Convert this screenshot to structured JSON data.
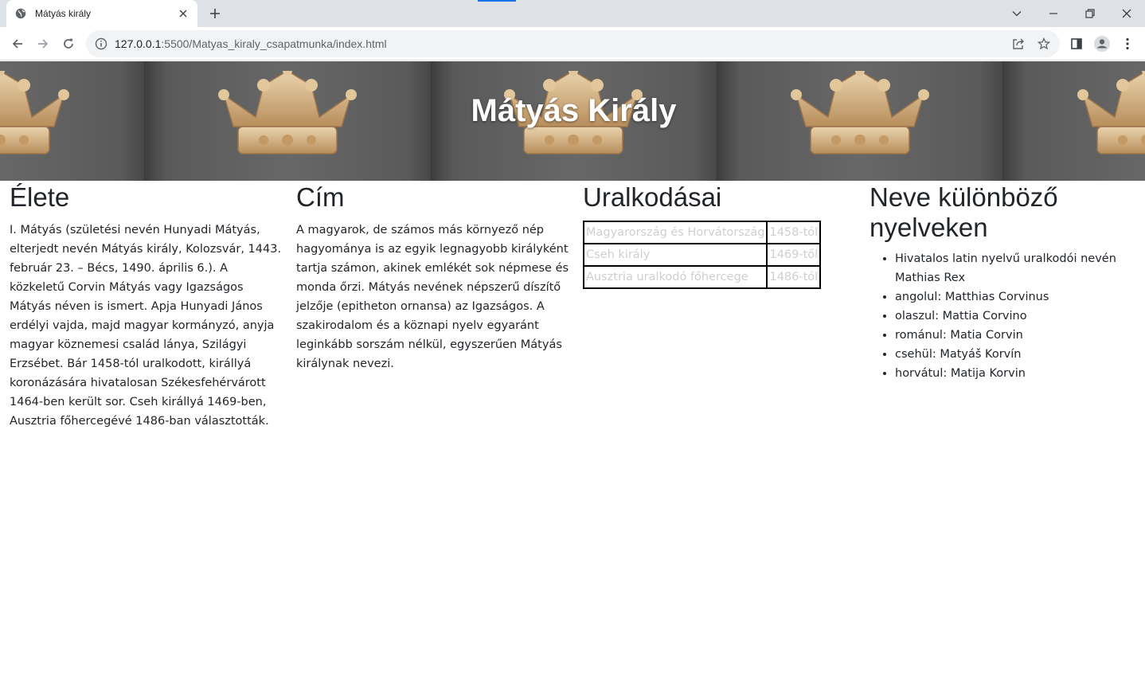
{
  "browser": {
    "tab_title": "Mátyás király",
    "url_host": "127.0.0.1",
    "url_rest": ":5500/Matyas_kiraly_csapatmunka/index.html"
  },
  "page": {
    "banner_title": "Mátyás Király",
    "life": {
      "heading": "Élete",
      "text": "I. Mátyás (születési nevén Hunyadi Mátyás, elterjedt nevén Mátyás király, Kolozsvár, 1443. február 23. – Bécs, 1490. április 6.). A közkeletű Corvin Mátyás vagy Igazságos Mátyás néven is ismert. Apja Hunyadi János erdélyi vajda, majd magyar kormányzó, anyja magyar köznemesi család lánya, Szilágyi Erzsébet. Bár 1458-tól uralkodott, királlyá koronázására hivatalosan Székesfehérvárott 1464-ben került sor. Cseh királlyá 1469-ben, Ausztria főhercegévé 1486-ban választották."
    },
    "title_col": {
      "heading": "Cím",
      "text": "A magyarok, de számos más környező nép hagyománya is az egyik legnagyobb királyként tartja számon, akinek emlékét sok népmese és monda őrzi. Mátyás nevének népszerű díszítő jelzője (epitheton ornansa) az Igazságos. A szakirodalom és a köznapi nyelv egyaránt leginkább sorszám nélkül, egyszerűen Mátyás királynak nevezi."
    },
    "reigns": {
      "heading": "Uralkodásai",
      "rows": [
        {
          "title": "Magyarország és Horvátország",
          "since": "1458-tól"
        },
        {
          "title": "Cseh király",
          "since": "1469-től"
        },
        {
          "title": "Ausztria uralkodó főhercege",
          "since": "1486-tól"
        }
      ]
    },
    "names": {
      "heading": "Neve különböző nyelveken",
      "items": [
        "Hivatalos latin nyelvű uralkodói nevén Mathias Rex",
        "angolul: Matthias Corvinus",
        "olaszul: Mattia Corvino",
        "románul: Matia Corvin",
        "csehül: Matyáš Korvín",
        "horvátul: Matija Korvin"
      ]
    }
  },
  "icons": {
    "favicon": "globe-icon",
    "tab_close": "close-icon",
    "new_tab": "plus-icon",
    "back": "arrow-left-icon",
    "forward": "arrow-right-icon",
    "reload": "reload-icon",
    "site_info": "info-icon",
    "share": "share-icon",
    "bookmark": "star-icon",
    "side_panel": "side-panel-icon",
    "profile": "profile-icon",
    "menu": "kebab-menu-icon"
  }
}
